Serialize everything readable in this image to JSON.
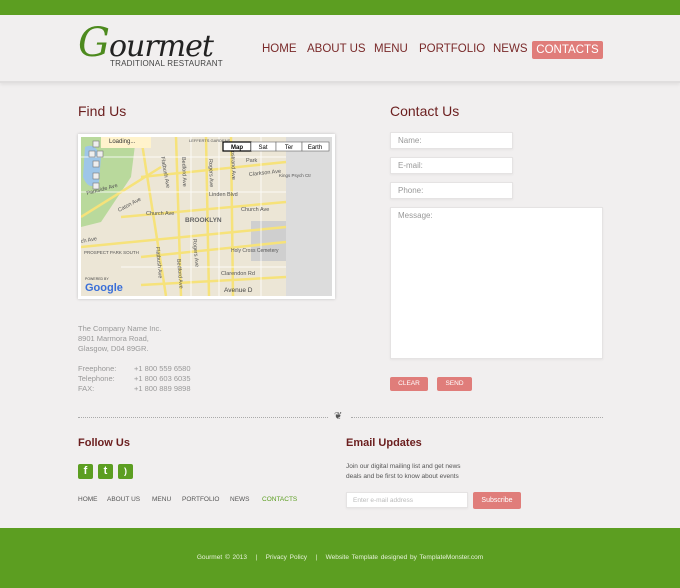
{
  "header": {
    "logo": "Gourmet",
    "logo_initial": "G",
    "logo_rest": "ourmet",
    "tagline": "TRADITIONAL RESTAURANT",
    "nav": [
      "HOME",
      "ABOUT US",
      "MENU",
      "PORTFOLIO",
      "NEWS",
      "CONTACTS"
    ],
    "active": "CONTACTS"
  },
  "find_us": {
    "title": "Find Us",
    "map": {
      "types": [
        "Map",
        "Sat",
        "Ter",
        "Earth"
      ],
      "selected_type": "Map",
      "loading": "Loading...",
      "powered": "POWERED BY",
      "google": "Google",
      "labels": [
        "Flatbush Ave",
        "Bedford Ave",
        "Rogers Ave",
        "Nostrand Ave",
        "Clarkson Ave",
        "Linden Blvd",
        "Caton Ave",
        "Church Ave",
        "Church Ave",
        "BROOKLYN",
        "Holy Cross Cemetery",
        "PROSPECT PARK SOUTH",
        "Clarendon Rd",
        "Avenue D",
        "Park",
        "LEFFERTS GARDENS",
        "Flatbush Ave",
        "Bedford Ave",
        "Rogers Ave",
        "Parkside Ave",
        "ch Ave",
        "Kings Psych Ctr"
      ]
    },
    "company": "The Company Name Inc.",
    "street": "8901 Marmora Road,",
    "city": "Glasgow, D04 89GR.",
    "phones": [
      {
        "label": "Freephone:",
        "value": "+1 800 559 6580"
      },
      {
        "label": "Telephone:",
        "value": "+1 800 603 6035"
      },
      {
        "label": "FAX:",
        "value": "+1 800 889 9898"
      }
    ]
  },
  "contact_us": {
    "title": "Contact Us",
    "name_ph": "Name:",
    "email_ph": "E-mail:",
    "phone_ph": "Phone:",
    "message_ph": "Message:",
    "clear": "CLEAR",
    "send": "SEND"
  },
  "follow": {
    "title": "Follow Us",
    "social": [
      "facebook-icon",
      "twitter-icon",
      "rss-icon"
    ],
    "nav": [
      "HOME",
      "ABOUT US",
      "MENU",
      "PORTFOLIO",
      "NEWS",
      "CONTACTS"
    ]
  },
  "email": {
    "title": "Email Updates",
    "text1": "Join our digital mailing list and get news",
    "text2": "deals and be first to know about events",
    "placeholder": "Enter e-mail address",
    "subscribe": "Subscribe"
  },
  "footer": {
    "copyright": "Gourmet © 2013",
    "sep": "|",
    "privacy": "Privacy Policy",
    "credit": "Website Template designed by TemplateMonster.com"
  },
  "colors": {
    "green": "#5c9e21",
    "accent": "#e07d7a",
    "heading": "#6b1e1e"
  }
}
